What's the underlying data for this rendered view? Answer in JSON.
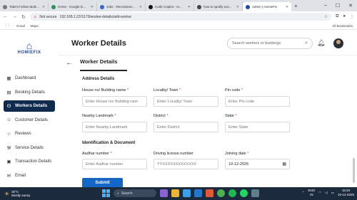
{
  "browser": {
    "tabs": [
      {
        "title": "Talent Forbes Mobi..."
      },
      {
        "title": "Home - Google D..."
      },
      {
        "title": "Jobs - Recruitmen..."
      },
      {
        "title": "Code Copilot - Ar..."
      },
      {
        "title": "how to spotify sce..."
      },
      {
        "title": "Admin | HomieFix",
        "active": true
      }
    ],
    "url_security": "Not secure",
    "url": "192.168.1.23:5173/worker-details/add-worker",
    "bookmarks": [
      "Gmail",
      "Maps"
    ],
    "all_bookmarks": "All Bookmarks"
  },
  "brand": {
    "name": "HOMIEFIX"
  },
  "sidebar": {
    "items": [
      {
        "label": "Dashboard",
        "icon": "grid-icon"
      },
      {
        "label": "Booking Details",
        "icon": "calendar-icon"
      },
      {
        "label": "Workers Details",
        "icon": "workers-icon",
        "active": true
      },
      {
        "label": "Customer Details",
        "icon": "user-icon"
      },
      {
        "label": "Reviews",
        "icon": "star-icon"
      },
      {
        "label": "Service Details",
        "icon": "tools-icon"
      },
      {
        "label": "Transaction Details",
        "icon": "receipt-icon"
      },
      {
        "label": "Email",
        "icon": "mail-icon"
      }
    ]
  },
  "header": {
    "title": "Worker Details",
    "search_placeholder": "Search workers or bookings"
  },
  "form": {
    "tab": "Worker Details",
    "address_heading": "Address Details",
    "house_label": "House no/ Building name",
    "house_placeholder": "Enter House no/ Building nam",
    "locality_label": "Locality/ Town",
    "locality_placeholder": "Enter Locality/ Town",
    "pincode_label": "Pin code",
    "pincode_placeholder": "Enter Pin code",
    "landmark_label": "Nearby Landmark",
    "landmark_placeholder": "Enter Nearby Landmark",
    "district_label": "District",
    "district_placeholder": "Enter District",
    "state_label": "State",
    "state_placeholder": "Enter State",
    "id_heading": "Identification & Document",
    "aadhar_label": "Aadhar number",
    "aadhar_placeholder": "Enter Aadhar number",
    "license_label": "Driving license number",
    "license_placeholder": "YYXXXXXXXXXXXXX",
    "joining_label": "Joining date",
    "joining_value": "10-12-2025",
    "submit_label": "Submit",
    "required_mark": "*"
  },
  "taskbar": {
    "temperature": "30°C",
    "weather": "Mostly sunny",
    "search_label": "Search",
    "lang_line1": "ENG",
    "lang_line2": "IN",
    "time": "15:20",
    "date": "10-12-2025"
  }
}
